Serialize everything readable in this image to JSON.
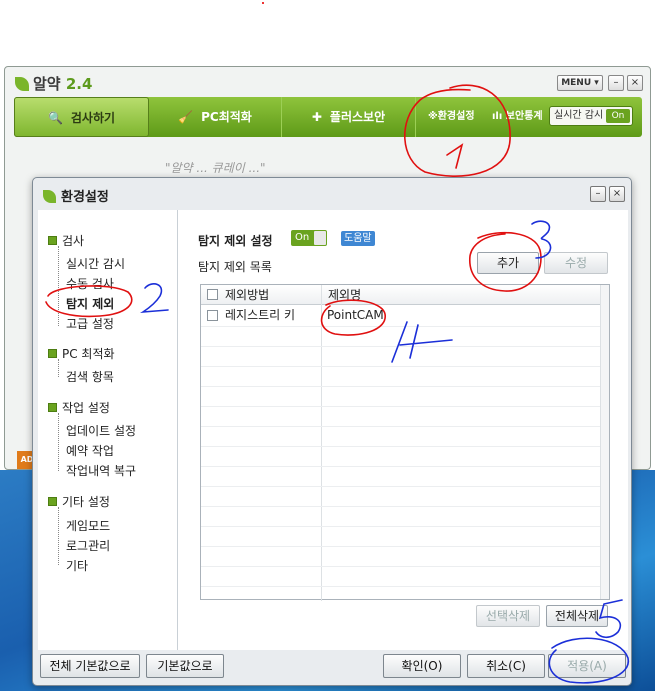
{
  "app": {
    "name": "알약",
    "version": "2.4",
    "menu_label": "MENU",
    "minimize": "–",
    "close": "×",
    "nav": [
      {
        "label": "검사하기"
      },
      {
        "label": "PC최적화"
      },
      {
        "label": "플러스보안"
      }
    ],
    "nav_right": {
      "settings": "※환경설정",
      "stats": "ılı 보안통계"
    },
    "live_monitor_label": "실시간 감시",
    "live_monitor_state": "On",
    "banner_text": "\"알약 ... 큐레이 ...\"",
    "ad_badge": "AD"
  },
  "dialog": {
    "title": "환경설정",
    "minimize": "–",
    "close": "×",
    "sidebar": {
      "groups": [
        {
          "label": "검사",
          "items": [
            "실시간 감시",
            "수동 검사",
            "탐지 제외",
            "고급 설정"
          ]
        },
        {
          "label": "PC 최적화",
          "items": [
            "검색 항목"
          ]
        },
        {
          "label": "작업 설정",
          "items": [
            "업데이트 설정",
            "예약 작업",
            "작업내역 복구"
          ]
        },
        {
          "label": "기타 설정",
          "items": [
            "게임모드",
            "로그관리",
            "기타"
          ]
        }
      ]
    },
    "content": {
      "section_title": "탐지 제외 설정",
      "toggle_state": "On",
      "help_label": "도움말",
      "list_label": "탐지 제외 목록",
      "add_button": "추가",
      "edit_button": "수정",
      "columns": [
        "제외방법",
        "제외명"
      ],
      "rows": [
        {
          "method": "레지스트리 키",
          "name": "PointCAM"
        }
      ],
      "delete_selected": "선택삭제",
      "delete_all": "전체삭제"
    },
    "footer": {
      "reset_all": "전체 기본값으로",
      "reset": "기본값으로",
      "ok": "확인(O)",
      "cancel": "취소(C)",
      "apply": "적용(A)"
    }
  },
  "annotations": [
    "1",
    "2",
    "3",
    "4",
    "5"
  ],
  "colors": {
    "accent_green": "#6aa31f",
    "annotation_red": "#e01010",
    "annotation_blue": "#1b2fd8"
  }
}
